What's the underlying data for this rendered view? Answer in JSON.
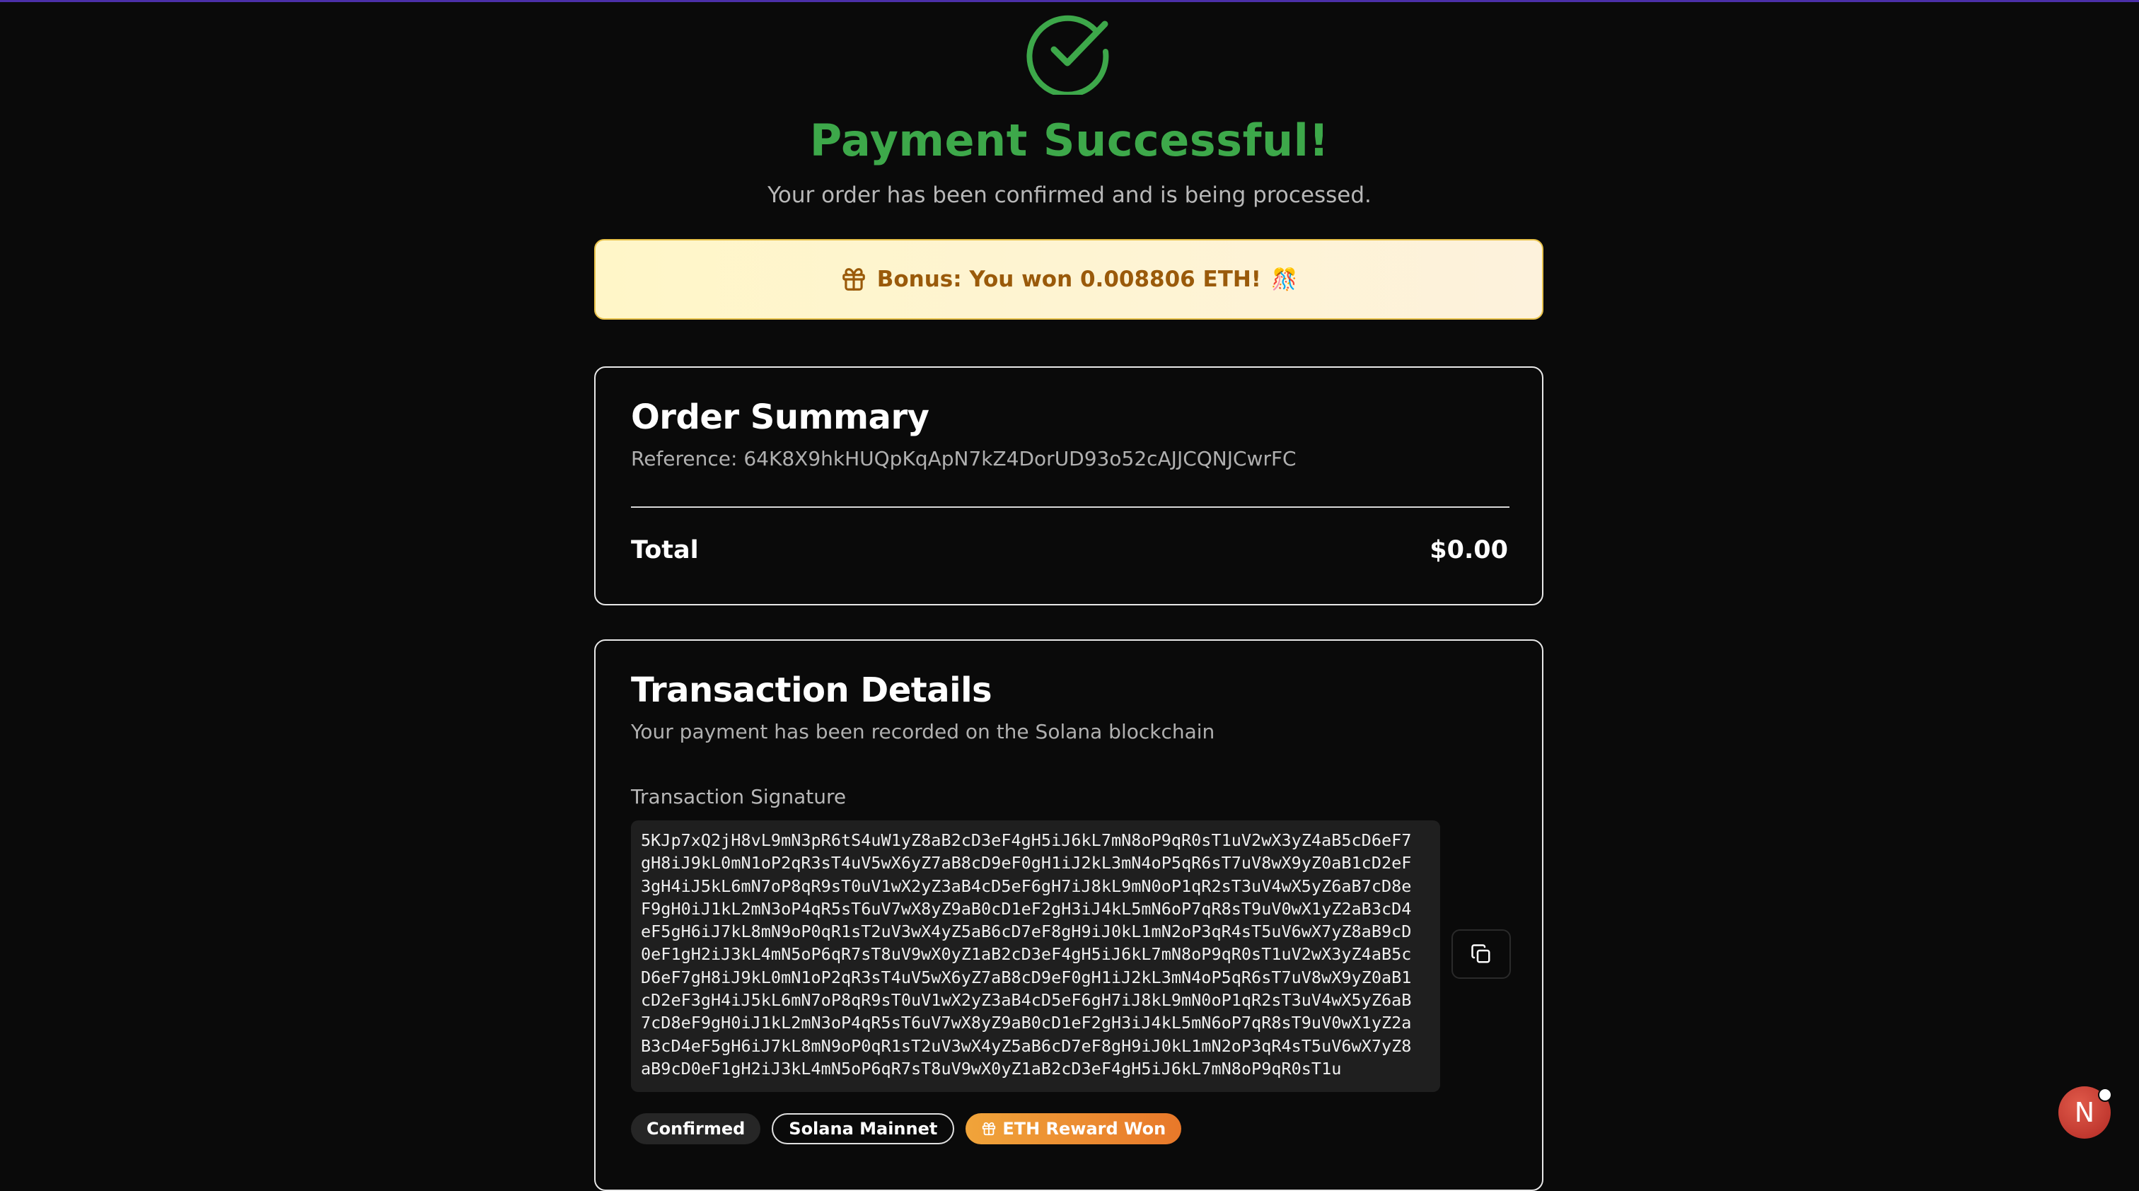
{
  "header": {
    "title": "Payment Successful!",
    "subtitle": "Your order has been confirmed and is being processed."
  },
  "bonus": {
    "text": "Bonus: You won 0.008806 ETH!",
    "emoji": "🎊"
  },
  "order_summary": {
    "title": "Order Summary",
    "reference": "Reference: 64K8X9hkHUQpKqApN7kZ4DorUD93o52cAJJCQNJCwrFC",
    "total_label": "Total",
    "total_value": "$0.00"
  },
  "transaction": {
    "title": "Transaction Details",
    "subtitle": "Your payment has been recorded on the Solana blockchain",
    "signature_label": "Transaction Signature",
    "signature_lines": [
      "5KJp7xQ2jH8vL9mN3pR6tS4uW1yZ8aB2cD3eF4gH5iJ6kL7mN8oP9qR0sT1uV2wX3yZ4aB5cD6eF7",
      "gH8iJ9kL0mN1oP2qR3sT4uV5wX6yZ7aB8cD9eF0gH1iJ2kL3mN4oP5qR6sT7uV8wX9yZ0aB1cD2eF",
      "3gH4iJ5kL6mN7oP8qR9sT0uV1wX2yZ3aB4cD5eF6gH7iJ8kL9mN0oP1qR2sT3uV4wX5yZ6aB7cD8e",
      "F9gH0iJ1kL2mN3oP4qR5sT6uV7wX8yZ9aB0cD1eF2gH3iJ4kL5mN6oP7qR8sT9uV0wX1yZ2aB3cD4",
      "eF5gH6iJ7kL8mN9oP0qR1sT2uV3wX4yZ5aB6cD7eF8gH9iJ0kL1mN2oP3qR4sT5uV6wX7yZ8aB9cD",
      "0eF1gH2iJ3kL4mN5oP6qR7sT8uV9wX0yZ1aB2cD3eF4gH5iJ6kL7mN8oP9qR0sT1uV2wX3yZ4aB5c",
      "D6eF7gH8iJ9kL0mN1oP2qR3sT4uV5wX6yZ7aB8cD9eF0gH1iJ2kL3mN4oP5qR6sT7uV8wX9yZ0aB1",
      "cD2eF3gH4iJ5kL6mN7oP8qR9sT0uV1wX2yZ3aB4cD5eF6gH7iJ8kL9mN0oP1qR2sT3uV4wX5yZ6aB",
      "7cD8eF9gH0iJ1kL2mN3oP4qR5sT6uV7wX8yZ9aB0cD1eF2gH3iJ4kL5mN6oP7qR8sT9uV0wX1yZ2a",
      "B3cD4eF5gH6iJ7kL8mN9oP0qR1sT2uV3wX4yZ5aB6cD7eF8gH9iJ0kL1mN2oP3qR4sT5uV6wX7yZ8",
      "aB9cD0eF1gH2iJ3kL4mN5oP6qR7sT8uV9wX0yZ1aB2cD3eF4gH5iJ6kL7mN8oP9qR0sT1u"
    ],
    "badges": {
      "status": "Confirmed",
      "network": "Solana Mainnet",
      "reward": "ETH Reward Won"
    }
  },
  "avatar": {
    "initial": "N"
  },
  "colors": {
    "success": "#3da84a",
    "bonus_bg": "#fff6c8",
    "bonus_text": "#9a5a0a",
    "reward_badge": "#f0a43a",
    "accent_line": "#4b2fa8"
  }
}
